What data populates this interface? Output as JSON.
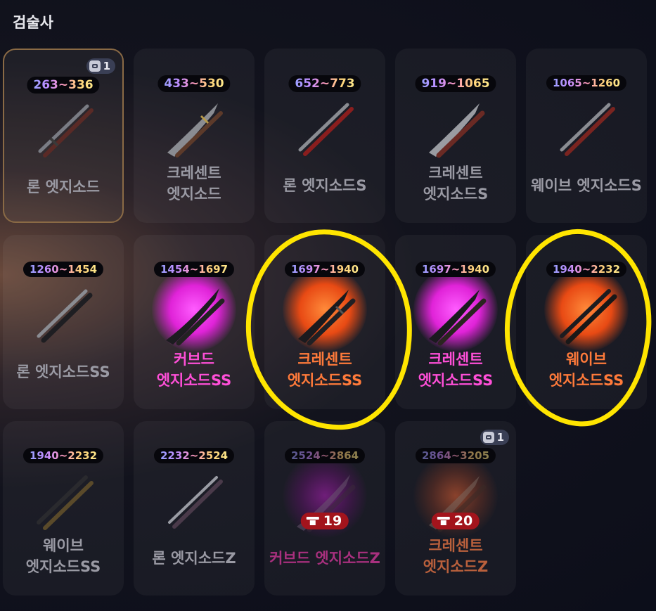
{
  "title": "검술사",
  "colors": {
    "selected_border": "#8a6a45",
    "pink": "#ff4fd8",
    "orange": "#ff7a3a",
    "cost_badge": "#a3141c",
    "annotation": "#ffe500"
  },
  "cards": [
    {
      "range": "263~336",
      "name": "론 엣지소드",
      "badge": "1",
      "icon": "bag-icon",
      "selected": true
    },
    {
      "range": "433~530",
      "name": "크레센트\n엣지소드"
    },
    {
      "range": "652~773",
      "name": "론 엣지소드S"
    },
    {
      "range": "919~1065",
      "name": "크레센트\n엣지소드S"
    },
    {
      "range": "1065~1260",
      "name": "웨이브 엣지소드S"
    },
    {
      "range": "1260~1454",
      "name": "론 엣지소드SS"
    },
    {
      "range": "1454~1697",
      "name": "커브드\n엣지소드SS",
      "glow": "pink"
    },
    {
      "range": "1697~1940",
      "name": "크레센트\n엣지소드SS",
      "glow": "orange"
    },
    {
      "range": "1697~1940",
      "name": "크레센트\n엣지소드SS",
      "glow": "pink"
    },
    {
      "range": "1940~2232",
      "name": "웨이브\n엣지소드SS",
      "glow": "orange"
    },
    {
      "range": "1940~2232",
      "name": "웨이브\n엣지소드SS"
    },
    {
      "range": "2232~2524",
      "name": "론 엣지소드Z"
    },
    {
      "range": "2524~2864",
      "name": "커브드 엣지소드Z",
      "cost": "19",
      "glow": "dimpurple",
      "locked": true
    },
    {
      "range": "2864~3205",
      "name": "크레센트\n엣지소드Z",
      "cost": "20",
      "badge": "1",
      "glow": "dimorange",
      "locked": true
    }
  ]
}
